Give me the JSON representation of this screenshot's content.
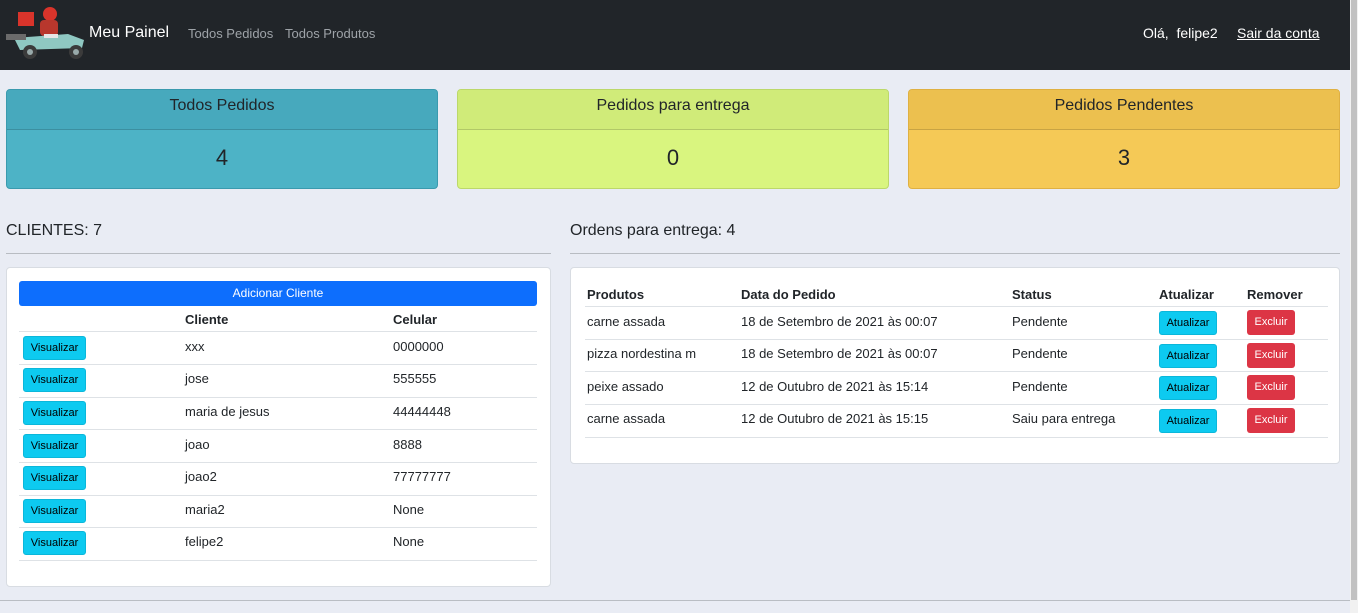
{
  "nav": {
    "brand": "Meu Painel",
    "links": [
      "Todos Pedidos",
      "Todos Produtos"
    ],
    "greeting": "Olá,  felipe2",
    "logout": "Sair da conta"
  },
  "cards": [
    {
      "title": "Todos Pedidos",
      "value": "4",
      "color": "#4db3c6"
    },
    {
      "title": "Pedidos para entrega",
      "value": "0",
      "color": "#d9f57f"
    },
    {
      "title": "Pedidos Pendentes",
      "value": "3",
      "color": "#f5c956"
    }
  ],
  "clients": {
    "title": "CLIENTES: 7",
    "add_label": "Adicionar Cliente",
    "headers": [
      "Cliente",
      "Celular"
    ],
    "view_label": "Visualizar",
    "rows": [
      {
        "name": "xxx",
        "phone": "0000000"
      },
      {
        "name": "jose",
        "phone": "555555"
      },
      {
        "name": "maria de jesus",
        "phone": "44444448"
      },
      {
        "name": "joao",
        "phone": "8888"
      },
      {
        "name": "joao2",
        "phone": "77777777"
      },
      {
        "name": "maria2",
        "phone": "None"
      },
      {
        "name": "felipe2",
        "phone": "None"
      }
    ]
  },
  "orders": {
    "title": "Ordens para entrega: 4",
    "headers": [
      "Produtos",
      "Data do Pedido",
      "Status",
      "Atualizar",
      "Remover"
    ],
    "update_label": "Atualizar",
    "delete_label": "Excluir",
    "rows": [
      {
        "product": "carne assada",
        "date": "18 de Setembro de 2021 às 00:07",
        "status": "Pendente"
      },
      {
        "product": "pizza nordestina m",
        "date": "18 de Setembro de 2021 às 00:07",
        "status": "Pendente"
      },
      {
        "product": "peixe assado",
        "date": "12 de Outubro de 2021 às 15:14",
        "status": "Pendente"
      },
      {
        "product": "carne assada",
        "date": "12 de Outubro de 2021 às 15:15",
        "status": "Saiu para entrega"
      }
    ]
  }
}
